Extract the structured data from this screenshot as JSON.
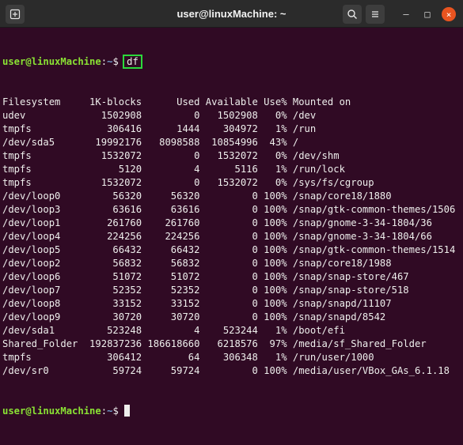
{
  "window": {
    "title": "user@linuxMachine: ~",
    "icons": {
      "new_tab": "new-tab-icon",
      "search": "search-icon",
      "menu": "hamburger-menu-icon"
    },
    "controls": {
      "minimize": "–",
      "maximize": "□",
      "close": "×"
    }
  },
  "prompt": {
    "user_host": "user@linuxMachine",
    "sep": ":",
    "path": "~",
    "symbol": "$ "
  },
  "command": "df",
  "output_lines": [
    "Filesystem     1K-blocks      Used Available Use% Mounted on",
    "udev             1502908         0   1502908   0% /dev",
    "tmpfs             306416      1444    304972   1% /run",
    "/dev/sda5       19992176   8098588  10854996  43% /",
    "tmpfs            1532072         0   1532072   0% /dev/shm",
    "tmpfs               5120         4      5116   1% /run/lock",
    "tmpfs            1532072         0   1532072   0% /sys/fs/cgroup",
    "/dev/loop0         56320     56320         0 100% /snap/core18/1880",
    "/dev/loop3         63616     63616         0 100% /snap/gtk-common-themes/1506",
    "/dev/loop1        261760    261760         0 100% /snap/gnome-3-34-1804/36",
    "/dev/loop4        224256    224256         0 100% /snap/gnome-3-34-1804/66",
    "/dev/loop5         66432     66432         0 100% /snap/gtk-common-themes/1514",
    "/dev/loop2         56832     56832         0 100% /snap/core18/1988",
    "/dev/loop6         51072     51072         0 100% /snap/snap-store/467",
    "/dev/loop7         52352     52352         0 100% /snap/snap-store/518",
    "/dev/loop8         33152     33152         0 100% /snap/snapd/11107",
    "/dev/loop9         30720     30720         0 100% /snap/snapd/8542",
    "/dev/sda1         523248         4    523244   1% /boot/efi",
    "Shared_Folder  192837236 186618660   6218576  97% /media/sf_Shared_Folder",
    "tmpfs             306412        64    306348   1% /run/user/1000",
    "/dev/sr0           59724     59724         0 100% /media/user/VBox_GAs_6.1.18"
  ],
  "colors": {
    "background": "#300a24",
    "prompt_user": "#8ae234",
    "prompt_path": "#729fcf",
    "highlight_box": "#2bd93b"
  }
}
